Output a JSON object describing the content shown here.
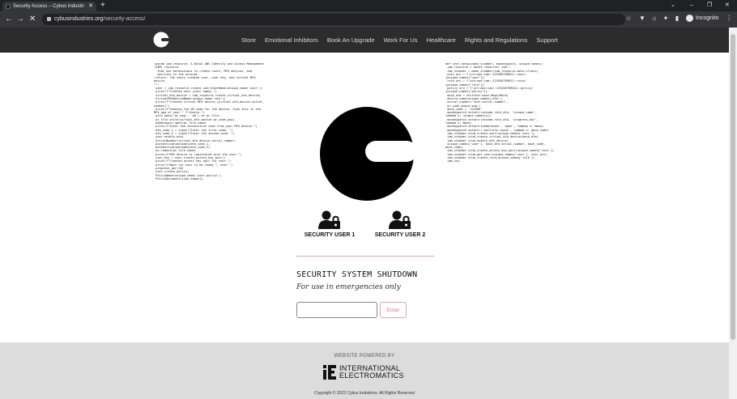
{
  "browser": {
    "tab_title": "Security Access – Cybus Industrie",
    "tab_close": "✕",
    "new_tab": "+",
    "url_domain": "cybusindustries.org",
    "url_path": "/security-access/",
    "incognito_label": "Incognito"
  },
  "nav": {
    "items": [
      "Store",
      "Emotional Inhibitors",
      "Book An Upgrade",
      "Work For Us",
      "Healthcare",
      "Rights and Regulations",
      "Support"
    ]
  },
  "code_left": ":param iam_resource: A Boto3 AWS Identity and Access Management\n(IAM) resource\n  that has permissions to create users, MFA devices, and\n  policies in the account.\n:return: The newly created user, user key, and virtual MFA\ndevice.\n\"\"\"\n user = iam_resource.create_user(UserName=unique_name('user'))\n print(f\"Created user {user.name}.\")\n virtual_mfa_device = iam_resource.create_virtual_mfa_device(\n VirtualMFADeviceName=unique_name('mfa'))\n print(f\"Created virtual MFA device {virtual_mfa_device.serial_\nnumber}\")\n print(f\"Showing the QR code for the device. Scan this in the\nMFA app of your \" f\"choice.\")\n with open('qr.png', 'wb') as qr_file:\n qr_file.write(virtual_mfa_device.qr_code_png)\n webbrowser.open(qr_file.name)\n print(f\"Enter two consecutive code from your MFA device.\")\n mfa_code_1 = input(\"Enter the first code: \")\n mfa_code_2 = input(\"Enter the second code: \")\n user.enable_mfa(\n SerialNumber=virtual_mfa_device.serial_number,\n AuthenticationCode1=mfa_code_1,\n AuthenticationCode2=mfa_code_2)\n os.remove(qr_file.name)\n print(f\"MFA device is registered with the user.\")\n user_key = user.create_access_key_pair()\n print(f\"Created access key pair for user.\")\n print(f\"Wait for user to be ready.\", end='')\n progress_bar(10)\n user.create_policy(\n PolicyName=unique_name('user-policy'),\n PolicyDocument=json.dumps({",
  "code_right": "def test_setup(make_stubber, monkeypatch, unique_names):\n iam_resource = boto3.resource('iam')\n iam_stubber = make_stubber(iam_resource.meta.client)\n user_arn = f'arn:aws:iam::123456789012::user/\n{unique_names[\"user\"]}'\n role_arn = f'arn:aws:iam::123456789012::role/\n{unique_names[\"role\"]}'\n policy_arn = f'arn:aws:iam::123456789012::policy/\n{unique_names[\"policy\"]}'\n mock_mfa = unittest.mock.MagicMock(\n device_name=unique_names['mfa'],\n serial_number='test-serial-number',\n qr_code_png=b'png')\n mock_code = '123456'\n monkeypatch.setattr(assume_role_mfa, 'unique_name',\nlambda x: unique_names[x])\n monkeypatch.setattr(assume_role_mfa, 'progress_bar',\nlambda x: None)\n monkeypatch.setattr(webbrowser, 'open', lambda x: None)\n monkeypatch.setattr('builtins.input', lambda x: mock_code)\n iam_stubber.stub_create_user(unique_names['user'])\n iam_stubber.stub_create_virtual_mfa_device(mock_mfa)\n iam_stubber.stub_enable_mfa_device(\n unique_names['user'], mock_mfa.serial_number, mock_code,\nmock_code)\n iam_stubber.stub_create_access_key_pair(unique_names['user'])\n iam_stubber.stub_get_user(unique_names['user'], user_arn)\n iam_stubber.stub_create_role(unique_names['role'])\n iam_stu-",
  "users": [
    {
      "label": "SECURITY USER 1"
    },
    {
      "label": "SECURITY USER 2"
    }
  ],
  "shutdown": {
    "title": "SECURITY SYSTEM SHUTDOWN",
    "subtitle": "For use in emergencies only",
    "input_value": "",
    "button_label": "Enter"
  },
  "footer": {
    "powered_by": "WEBSITE POWERED BY",
    "brand_line1": "INTERNATIONAL",
    "brand_line2": "ELECTROMATICS",
    "copyright": "Copyright © 2022 Cybus Industries. All Rights Reserved"
  },
  "colors": {
    "header_bg": "#2c2c2c",
    "accent_pink": "#e3a1a8",
    "footer_bg": "#dcdcdc"
  }
}
